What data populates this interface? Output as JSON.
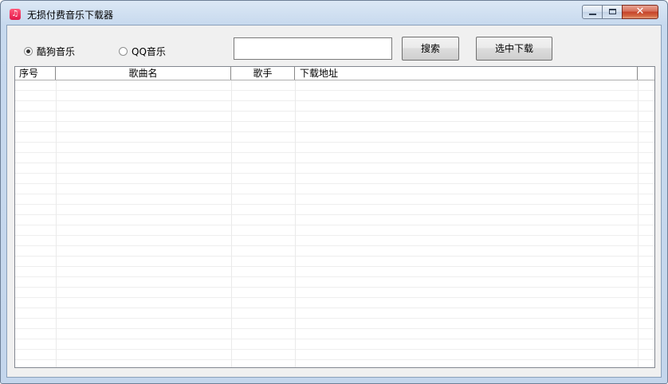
{
  "window": {
    "title": "无损付费音乐下载器",
    "icon": "music-note-icon",
    "controls": {
      "minimize": "minimize-icon",
      "maximize": "maximize-icon",
      "close": "✕"
    }
  },
  "toolbar": {
    "source_options": [
      {
        "label": "酷狗音乐",
        "selected": true
      },
      {
        "label": "QQ音乐",
        "selected": false
      }
    ],
    "search": {
      "value": "",
      "placeholder": ""
    },
    "search_button": "搜索",
    "download_button": "选中下载"
  },
  "table": {
    "columns": [
      "序号",
      "歌曲名",
      "歌手",
      "下载地址"
    ],
    "rows": []
  }
}
